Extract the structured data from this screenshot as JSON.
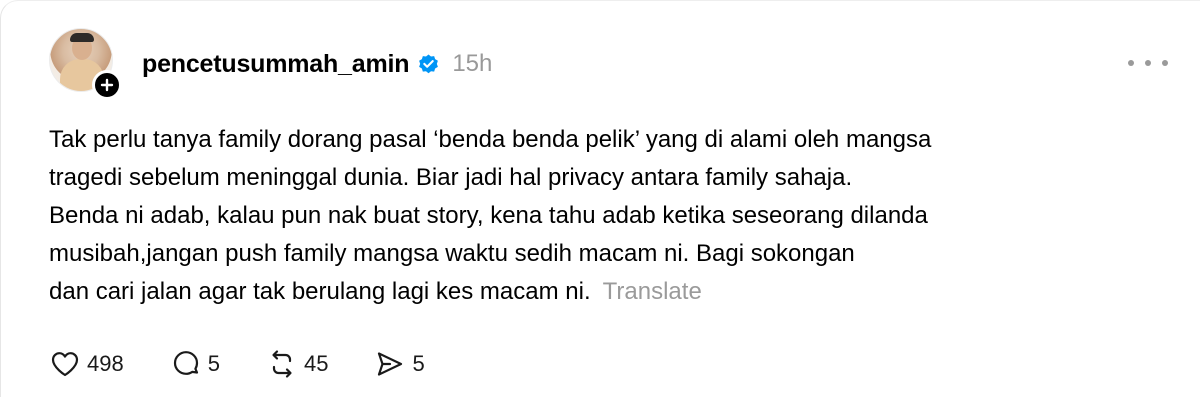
{
  "post": {
    "author": {
      "username": "pencetusummah_amin",
      "verified": true,
      "avatar_icon": "profile-photo",
      "follow_icon": "plus-icon"
    },
    "time": "15h",
    "more_icon": "ellipsis-icon",
    "body_lines": [
      "Tak perlu tanya family dorang pasal ‘benda benda pelik’ yang di alami oleh mangsa",
      "tragedi sebelum meninggal dunia. Biar jadi hal privacy antara family sahaja.",
      "Benda ni adab, kalau pun nak buat story, kena tahu adab ketika seseorang dilanda",
      "musibah,jangan push family mangsa waktu sedih macam ni. Bagi sokongan",
      "dan cari jalan agar tak berulang lagi kes macam ni."
    ],
    "translate_label": "Translate",
    "actions": {
      "like": {
        "icon": "heart-icon",
        "count": "498"
      },
      "reply": {
        "icon": "comment-icon",
        "count": "5"
      },
      "repost": {
        "icon": "repost-icon",
        "count": "45"
      },
      "share": {
        "icon": "send-icon",
        "count": "5"
      }
    }
  },
  "colors": {
    "text": "#000000",
    "muted": "#999999",
    "verified": "#0095f6"
  }
}
